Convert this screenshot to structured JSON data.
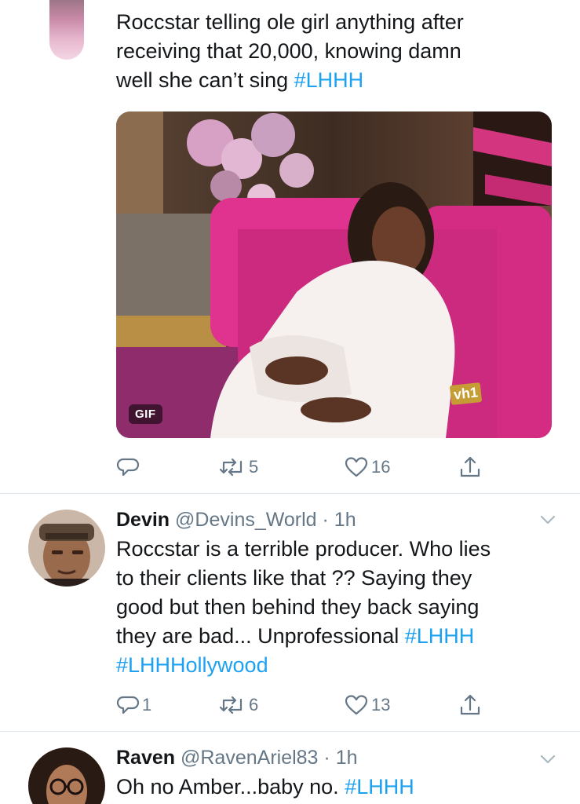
{
  "tweets": [
    {
      "text_lines": [
        "Roccstar telling ole girl anything after",
        "receiving that 20,000, knowing damn",
        "well she can’t sing "
      ],
      "hashtag": "#LHHH",
      "media": {
        "type": "gif",
        "badge": "GIF",
        "watermark": "vh1"
      },
      "actions": {
        "reply": "",
        "retweet": "5",
        "like": "16"
      }
    },
    {
      "name": "Devin",
      "handle": "@Devins_World",
      "time": "· 1h",
      "text_lines": [
        "Roccstar is a terrible producer. Who lies",
        "to their clients like that ?? Saying they",
        "good but then behind they back saying",
        "they are bad... Unprofessional "
      ],
      "hashtags": [
        "#LHHH",
        "#LHHHollywood"
      ],
      "actions": {
        "reply": "1",
        "retweet": "6",
        "like": "13"
      }
    },
    {
      "name": "Raven",
      "handle": "@RavenAriel83",
      "time": "· 1h",
      "text": "Oh no Amber...baby no. ",
      "hashtag": "#LHHH"
    }
  ],
  "icons": [
    "reply-icon",
    "retweet-icon",
    "like-icon",
    "share-icon",
    "chevron-down-icon"
  ],
  "colors": {
    "link": "#1da1f2",
    "secondary": "#657786",
    "divider": "#e1e8ed"
  }
}
